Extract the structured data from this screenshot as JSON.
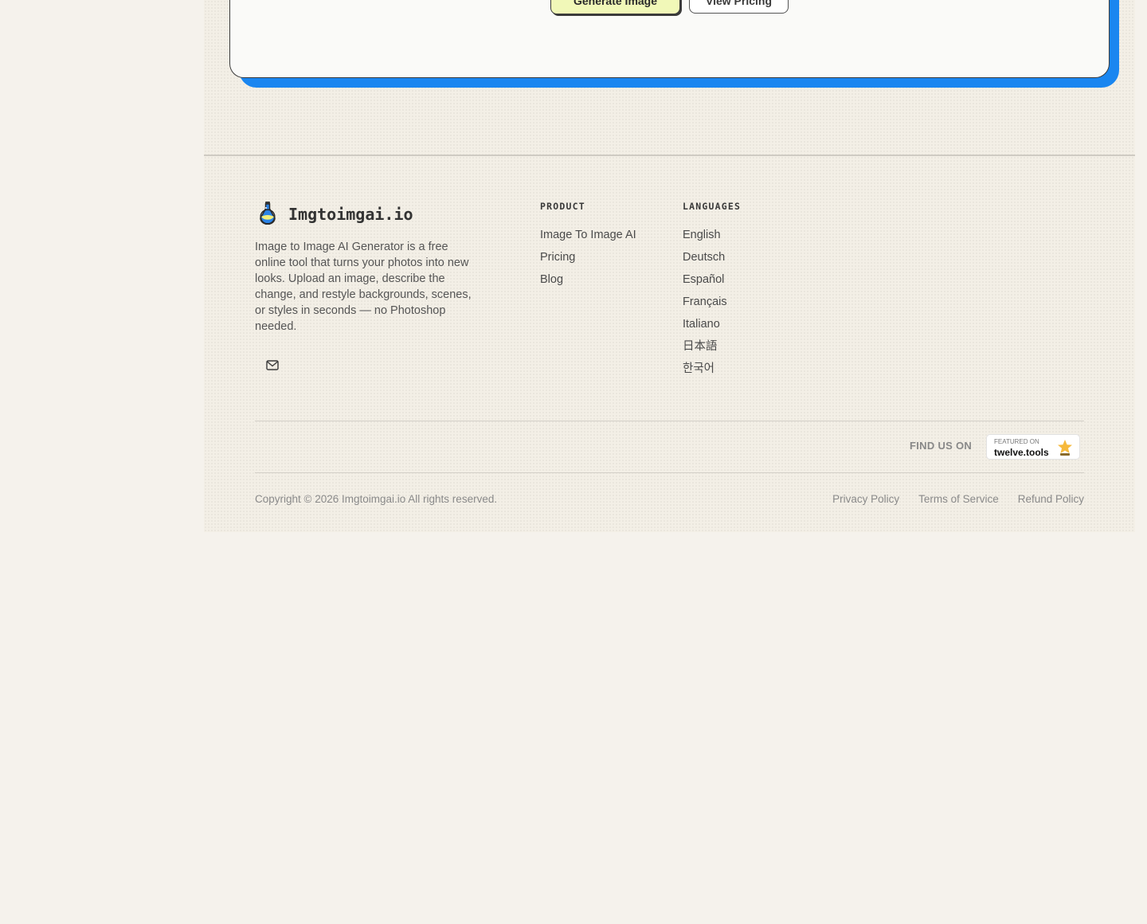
{
  "cta": {
    "primary_label": "Generate Image",
    "secondary_label": "View Pricing"
  },
  "footer": {
    "brand": {
      "name": "Imgtoimgai.io",
      "icon": "flask-logo-icon"
    },
    "description": "Image to Image AI Generator is a free online tool that turns your photos into new looks. Upload an image, describe the change, and restyle backgrounds, scenes, or styles in seconds — no Photoshop needed.",
    "contact_icon": "mail-icon",
    "product": {
      "title": "PRODUCT",
      "links": [
        "Image To Image AI",
        "Pricing",
        "Blog"
      ]
    },
    "languages": {
      "title": "LANGUAGES",
      "links": [
        "English",
        "Deutsch",
        "Español",
        "Français",
        "Italiano",
        "日本語",
        "한국어"
      ]
    },
    "find_us": "FIND US ON",
    "badge": {
      "small": "FEATURED ON",
      "name": "twelve.tools"
    },
    "copyright": "Copyright © 2026 Imgtoimgai.io All rights reserved.",
    "legal": [
      "Privacy Policy",
      "Terms of Service",
      "Refund Policy"
    ]
  },
  "colors": {
    "page_bg": "#f5f2ec",
    "accent_blue": "#1a86f0",
    "primary_button": "#f1f8b8"
  }
}
